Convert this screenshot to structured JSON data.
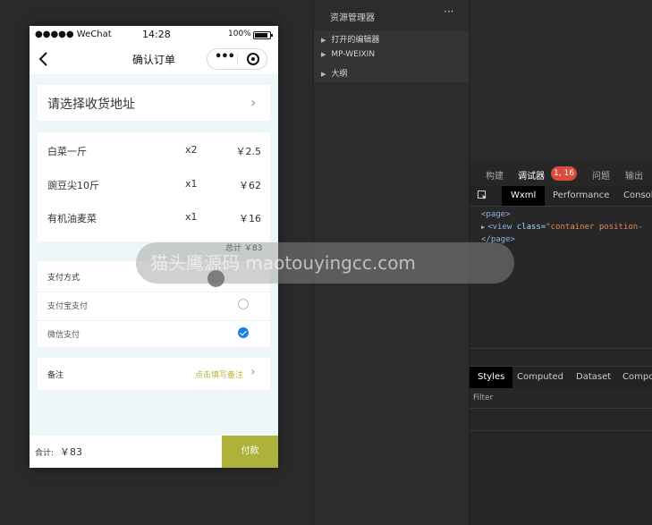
{
  "phone": {
    "status": {
      "carrier": "●●●●● WeChat",
      "time": "14:28",
      "battery": "100%"
    },
    "nav": {
      "title": "确认订单",
      "menu_dots": "•••"
    },
    "address": {
      "label": "请选择收货地址",
      "chevron": "›"
    },
    "goods": [
      {
        "name": "白菜一斤",
        "qty": "x2",
        "price": "￥2.5"
      },
      {
        "name": "豌豆尖10斤",
        "qty": "x1",
        "price": "￥62"
      },
      {
        "name": "有机油麦菜",
        "qty": "x1",
        "price": "￥16"
      }
    ],
    "goods_total": "总计 ￥83",
    "payment": {
      "title": "支付方式",
      "options": [
        {
          "name": "支付宝支付",
          "checked": false
        },
        {
          "name": "微信支付",
          "checked": true
        }
      ]
    },
    "remark": {
      "label": "备注",
      "hint": "点击填写备注",
      "chevron": "›"
    },
    "bottom": {
      "total_label": "合计:",
      "total_value": "￥83",
      "pay_button": "付款"
    }
  },
  "watermark": "猫头鹰源码 maotouyingcc.com",
  "explorer": {
    "title": "资源管理器",
    "more": "···",
    "items": [
      "打开的编辑器",
      "MP-WEIXIN",
      "大纲"
    ]
  },
  "devtools": {
    "tabs": [
      "构建",
      "调试器",
      "问题",
      "输出"
    ],
    "badge": "1, 16",
    "subtabs": [
      "Wxml",
      "Performance",
      "Consol"
    ],
    "code": {
      "line1": "<page>",
      "line2_tag": "<view",
      "line2_attr": " class=",
      "line2_val": "\"container position-",
      "line3": "</page>"
    },
    "panel_tabs": [
      "Styles",
      "Computed",
      "Dataset",
      "Compo"
    ],
    "filter_placeholder": "Filter"
  },
  "colors": {
    "accent": "#afb23a",
    "radio_checked": "#1a7ee3",
    "badge": "#d94b3c",
    "hint": "#b5b535"
  }
}
